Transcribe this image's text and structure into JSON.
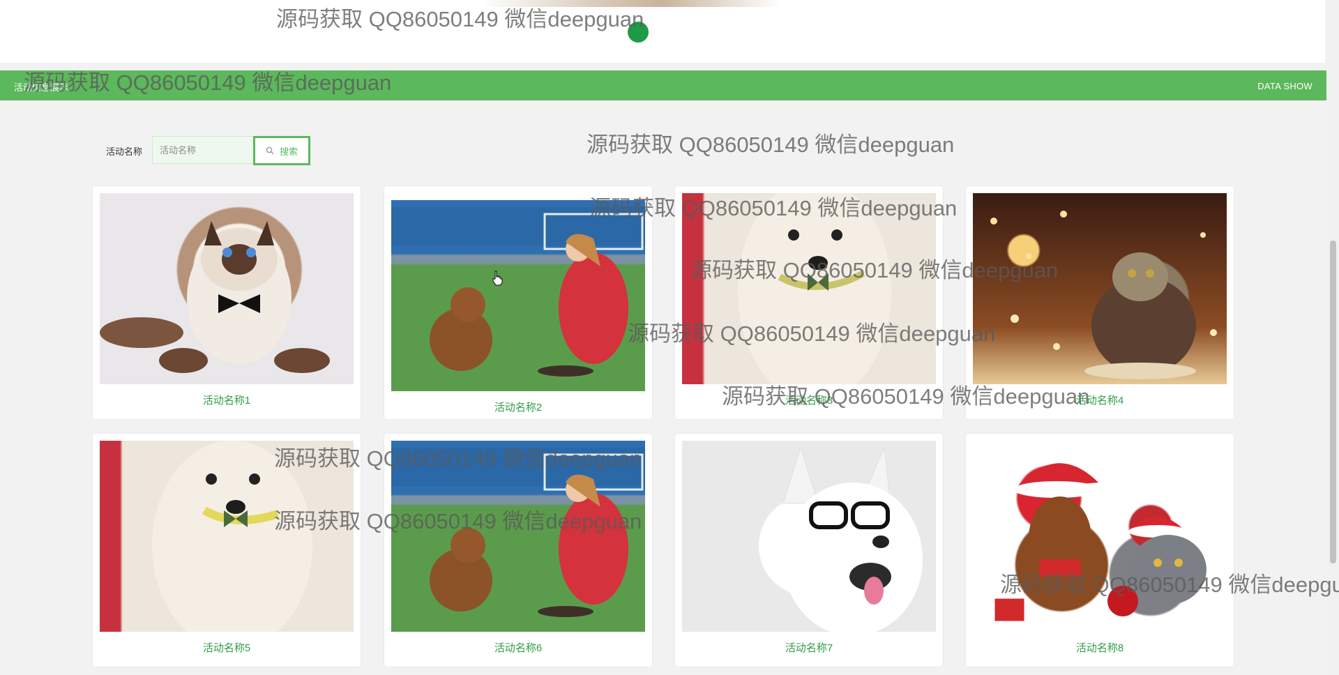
{
  "header": {
    "section_title": "活动信息展示",
    "section_subtitle": "DATA SHOW"
  },
  "search": {
    "label": "活动名称",
    "placeholder": "活动名称",
    "button_label": "搜索",
    "button_icon": "search-icon"
  },
  "cards": [
    {
      "title": "活动名称1"
    },
    {
      "title": "活动名称2"
    },
    {
      "title": "活动名称3"
    },
    {
      "title": "活动名称4"
    },
    {
      "title": "活动名称5"
    },
    {
      "title": "活动名称6"
    },
    {
      "title": "活动名称7"
    },
    {
      "title": "活动名称8"
    }
  ],
  "watermark": {
    "text": "源码获取 QQ86050149 微信deepguan",
    "text_clipped": "源码获取 QQ86050149 微信deepgu"
  },
  "colors": {
    "accent": "#5cb85c",
    "dot": "#1f9a48",
    "caption": "#2f9e44"
  }
}
